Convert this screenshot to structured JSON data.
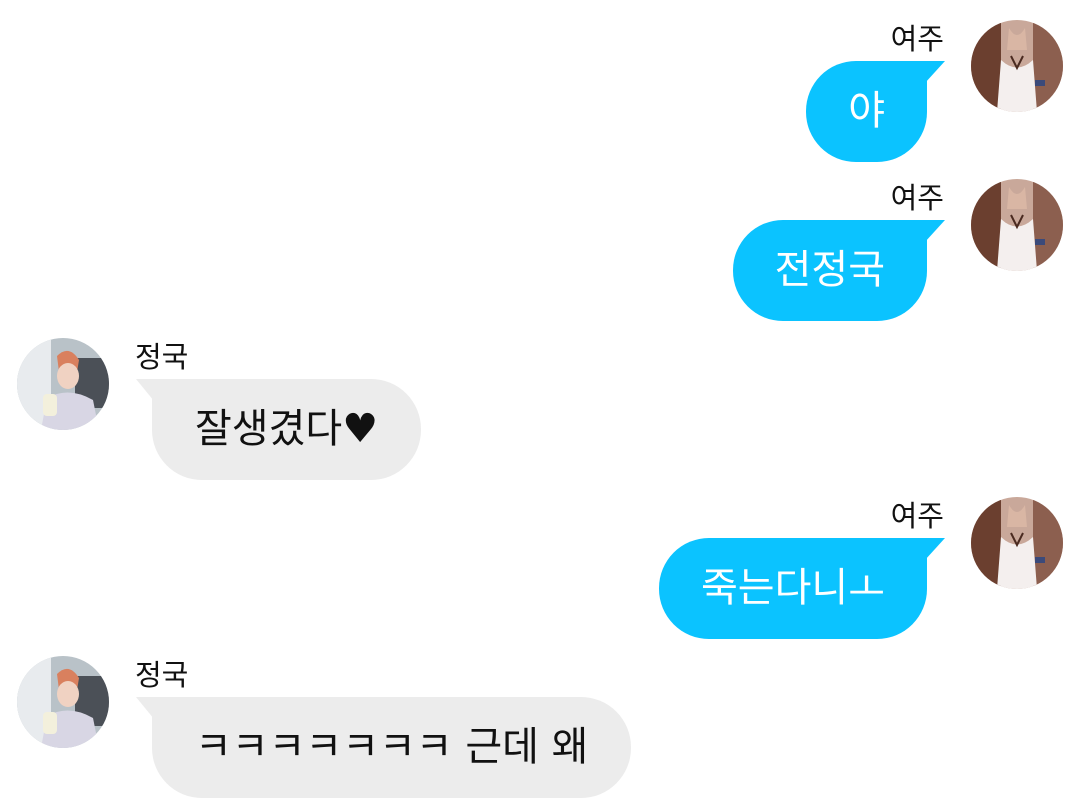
{
  "messages": [
    {
      "side": "right",
      "sender": "여주",
      "text": "야",
      "avatar": "female-avatar"
    },
    {
      "side": "right",
      "sender": "여주",
      "text": "전정국",
      "avatar": "female-avatar"
    },
    {
      "side": "left",
      "sender": "정국",
      "text": "잘생겼다♥",
      "avatar": "male-avatar"
    },
    {
      "side": "right",
      "sender": "여주",
      "text": "죽는다니ㅗ",
      "avatar": "female-avatar"
    },
    {
      "side": "left",
      "sender": "정국",
      "text": "ㅋㅋㅋㅋㅋㅋㅋ 근데 왜",
      "avatar": "male-avatar"
    }
  ],
  "colors": {
    "sent_bubble": "#0bc3ff",
    "received_bubble": "#ececec",
    "background": "#ffffff"
  }
}
